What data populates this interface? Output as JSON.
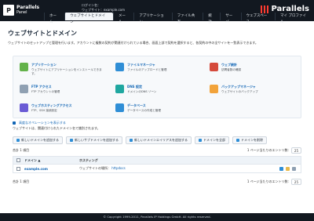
{
  "header": {
    "brand_title": "Parallels",
    "brand_subtitle": "Panel",
    "login_line1": "ログイン名：",
    "login_line2": "ウェブサイト：example.com",
    "parallels": "Parallels"
  },
  "nav": {
    "items": [
      {
        "label": "ホーム"
      },
      {
        "label": "ウェブサイトとドメイン"
      },
      {
        "label": "メール"
      },
      {
        "label": "アプリケーション"
      },
      {
        "label": "ファイル共有"
      },
      {
        "label": "統計"
      },
      {
        "label": "サーバ"
      },
      {
        "label": "ウェブスペース"
      },
      {
        "label": "マイ プロファイル"
      }
    ]
  },
  "page": {
    "title": "ウェブサイトとドメイン",
    "description": "ウェブサイトのセットアップと管理を行います。アカウントに複数の契約が関連付けられている場合、画面上部で契約を選択すると、各契約の中の全サイトを一覧表示できます。"
  },
  "tiles": [
    {
      "title": "アプリケーション",
      "desc": "ウェブサイトにアプリケーションをインストールできます。"
    },
    {
      "title": "ファイルマネージャ",
      "desc": "ファイルのアップロードと管理"
    },
    {
      "title": "ウェブ統計",
      "desc": "訪問者数の確認"
    },
    {
      "title": "FTP アクセス",
      "desc": "FTP アカウントの管理"
    },
    {
      "title": "DNS 設定",
      "desc": "ドメインのDNS ゾーン"
    },
    {
      "title": "バックアップマネージャ",
      "desc": "ウェブサイトのバックアップ"
    },
    {
      "title": "ウェブホスティングアクセス",
      "desc": "FTP、SSH 接続設定"
    },
    {
      "title": "データベース",
      "desc": "データベースの作成と管理"
    }
  ],
  "more_link": "高度なオペレーションを表示する",
  "info_text": "ウェブサイトは、関連付けられたドメイン名で識別されます。",
  "toolbar": {
    "buttons": [
      {
        "label": "新しいドメインを追加する"
      },
      {
        "label": "新しいサブドメインを追加する"
      },
      {
        "label": "新しいドメインエイリアスを追加する"
      },
      {
        "label": "ドメインを全部"
      },
      {
        "label": "ドメインを削除"
      }
    ]
  },
  "table": {
    "total": "合計 1 項目",
    "pager_label": "1 ページ当たりのエントリ数:",
    "pager_value": "25",
    "headers": {
      "domain": "ドメイン ▲",
      "hosting": "ホスティング"
    },
    "rows": [
      {
        "domain": "example.com",
        "hosting": "ウェブサイトの場所：",
        "hosting_link": "httpdocs"
      }
    ],
    "bottom_total": "合計 1 項目"
  },
  "footer": {
    "text": "© Copyright 1999-2011, Parallels IP Holdings GmbH. All rights reserved."
  }
}
